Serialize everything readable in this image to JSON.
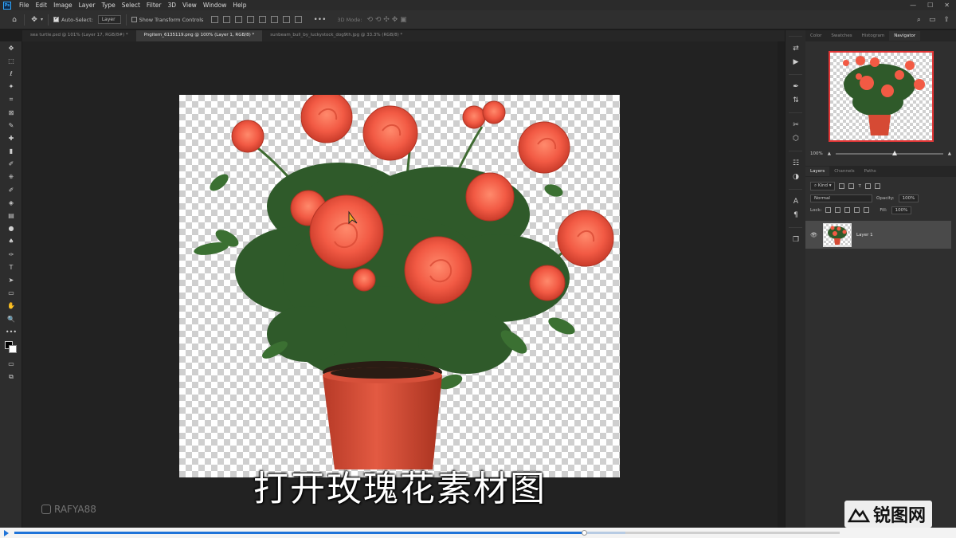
{
  "app": {
    "logo_text": "Ps"
  },
  "menu": [
    "File",
    "Edit",
    "Image",
    "Layer",
    "Type",
    "Select",
    "Filter",
    "3D",
    "View",
    "Window",
    "Help"
  ],
  "window_controls": [
    "—",
    "☐",
    "✕"
  ],
  "options": {
    "auto_select_label": "Auto-Select:",
    "auto_select_target": "Layer",
    "show_transform_label": "Show Transform Controls",
    "mode_3d_label": "3D Mode:",
    "more": "•••"
  },
  "tabs": [
    {
      "label": "sea turtle.psd @ 101% (Layer 17, RGB/8#) *",
      "active": false
    },
    {
      "label": "Pngitem_6135119.png @ 100% (Layer 1, RGB/8) *",
      "active": true
    },
    {
      "label": "sunbeam_bull_by_luckystock_dog9th.jpg @ 33.3% (RGB/8) *",
      "active": false
    }
  ],
  "tools": [
    "✥",
    "⬚",
    "ℓ",
    "✦",
    "⌗",
    "⊠",
    "✎",
    "✚",
    "▮",
    "✐",
    "⎈",
    "✐",
    "◈",
    "▤",
    "●",
    "♠",
    "✑",
    "T",
    "➤",
    "▭",
    "✋",
    "🔍",
    "•••"
  ],
  "canvas": {
    "subtitle": "打开玫瑰花素材图",
    "watermark": "RAFYA88"
  },
  "right_strip_icons": [
    "⇄",
    "▶",
    "✒",
    "⇅",
    "✂",
    "⬡",
    "☷",
    "◑",
    "A",
    "¶",
    "❐"
  ],
  "panels": {
    "top_tabs": [
      "Color",
      "Swatches",
      "Histogram",
      "Navigator"
    ],
    "active_top_tab": "Navigator",
    "zoom_text": "100%",
    "zoom_fraction": 0.55,
    "layer_tabs": [
      "Layers",
      "Channels",
      "Paths"
    ],
    "kind_label": "Kind",
    "blend_mode": "Normal",
    "opacity_label": "Opacity:",
    "opacity_value": "100%",
    "lock_label": "Lock:",
    "fill_label": "Fill:",
    "fill_value": "100%",
    "layers": [
      {
        "name": "Layer 1",
        "visible": true
      }
    ]
  },
  "player": {
    "progress_fraction": 0.69,
    "buffer_fraction": 0.74
  },
  "brand": {
    "text": "锐图网"
  },
  "colors": {
    "accent_blue": "#1e73d8",
    "rose": "#f25a44",
    "pot": "#d64a34",
    "leaf": "#2f5a2a",
    "nav_frame": "#e23636"
  }
}
